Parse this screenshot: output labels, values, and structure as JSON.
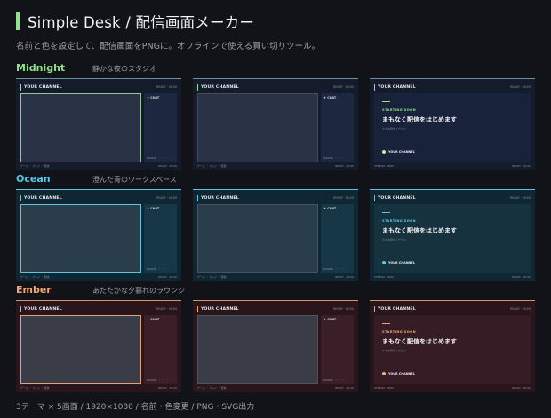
{
  "app": {
    "title": "Simple Desk / 配信画面メーカー",
    "subtitle": "名前と色を設定して、配信画面をPNGに。オフラインで使える買い切りツール。",
    "accent": "#8fe388"
  },
  "common": {
    "channel": "YOUR CHANNEL",
    "meta": "READY · 00:00",
    "chat": "♦ CHAT",
    "chat_foot": "ROOMS · ・・・・",
    "foot_left": "ゲーム ・ プレイ ・ 配信",
    "foot_right": "READY · 00:00",
    "starting_eyebrow": "STARTING SOON",
    "starting_headline": "まもなく配信をはじめます",
    "starting_sub": "少々お待ちください",
    "starting_dot_label": "YOUR CHANNEL",
    "starting_foot_left": "STREAM · 0000",
    "starting_foot_right": "READY · 00:00"
  },
  "themes": [
    {
      "name": "Midnight",
      "desc": "静かな夜のスタジオ",
      "colors": {
        "label": "#8fe388",
        "border": "#6e8fa0",
        "bg": "#141c2c",
        "cam": "#2a3346",
        "cam_border": "#8fc99a",
        "chat": "#1c2740",
        "panel": "#18223a",
        "dot": "#c8ec8c"
      }
    },
    {
      "name": "Ocean",
      "desc": "澄んだ青のワークスペース",
      "colors": {
        "label": "#58c9e6",
        "border": "#5cc6de",
        "bg": "#0f2733",
        "cam": "#2a3d4a",
        "cam_border": "#5cc6de",
        "chat": "#163846",
        "panel": "#17323f",
        "dot": "#58c9e6"
      }
    },
    {
      "name": "Ember",
      "desc": "あたたかな夕暮れのラウンジ",
      "colors": {
        "label": "#f0a871",
        "border": "#d8956a",
        "bg": "#2a151c",
        "cam": "#3a3d48",
        "cam_border": "#e0a27a",
        "chat": "#3a1f28",
        "panel": "#351c25",
        "dot": "#f0b27a"
      }
    }
  ],
  "footer": "3テーマ × 5画面 / 1920×1080 / 名前・色変更 / PNG・SVG出力"
}
